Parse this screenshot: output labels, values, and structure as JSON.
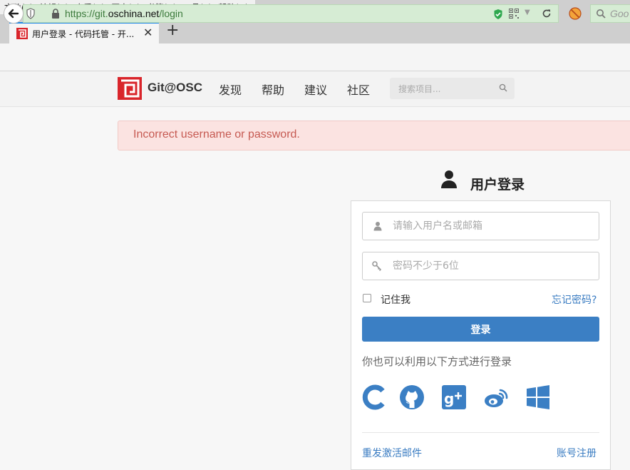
{
  "browser": {
    "menu": [
      "文件(F)",
      "编辑(E)",
      "查看(V)",
      "历史(S)",
      "书签(B)",
      "工具(T)",
      "帮助(H)"
    ],
    "tab_title": "用户登录 - 代码托管 - 开...",
    "url_scheme": "https://git.",
    "url_host": "oschina.net",
    "url_path": "/login",
    "search_placeholder": "Goo"
  },
  "header": {
    "logo_text": "Git@OSC",
    "nav": [
      "发现",
      "帮助",
      "建议",
      "社区"
    ],
    "search_placeholder": "搜索项目..."
  },
  "alert": {
    "message": "Incorrect username or password."
  },
  "login": {
    "title": "用户登录",
    "username_placeholder": "请输入用户名或邮箱",
    "password_placeholder": "密码不少于6位",
    "remember_label": "记住我",
    "forgot_label": "忘记密码?",
    "submit_label": "登录",
    "alt_login_text": "你也可以利用以下方式进行登录",
    "social": [
      "csdn-icon",
      "github-icon",
      "google-plus-icon",
      "weibo-icon",
      "windows-icon"
    ],
    "resend_activation": "重发激活邮件",
    "register": "账号注册"
  },
  "colors": {
    "brand_red": "#d9252b",
    "primary_blue": "#3b7fc4",
    "alert_bg": "#fbe3e1",
    "alert_text": "#c65a52",
    "url_green": "#d6ecd4"
  }
}
